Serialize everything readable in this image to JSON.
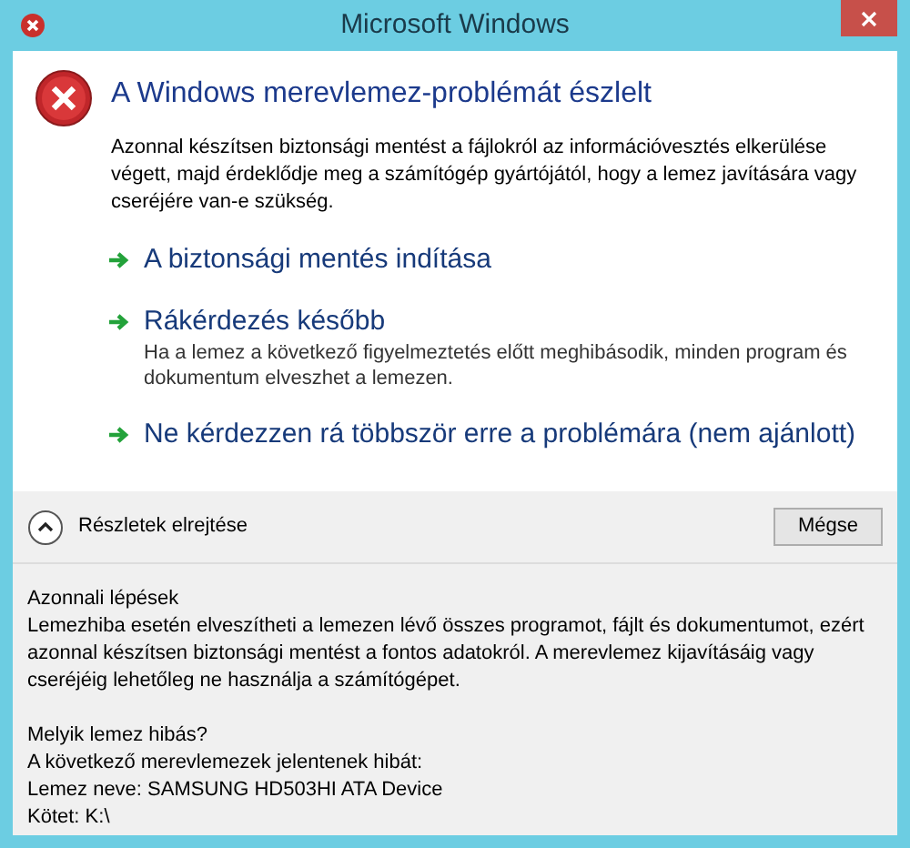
{
  "window": {
    "title": "Microsoft Windows"
  },
  "main_instruction": "A Windows merevlemez-problémát észlelt",
  "content": "Azonnal készítsen biztonsági mentést a fájlokról az információvesztés elkerülése végett, majd érdeklődje meg a számítógép gyártójától, hogy a lemez javítására vagy cseréjére van-e szükség.",
  "commands": [
    {
      "title": "A biztonsági mentés indítása"
    },
    {
      "title": "Rákérdezés később",
      "description": "Ha a lemez a következő figyelmeztetés előtt meghibásodik, minden program és dokumentum elveszhet a lemezen."
    },
    {
      "title": "Ne kérdezzen rá többször erre a problémára (nem ajánlott)"
    }
  ],
  "details_toggle": {
    "label": "Részletek elrejtése",
    "expanded": true
  },
  "buttons": [
    "Mégse"
  ],
  "details": [
    {
      "kind": "line",
      "text": "Azonnali lépések"
    },
    {
      "kind": "paragraph",
      "text": "Lemezhiba esetén elveszítheti a lemezen lévő összes programot, fájlt és dokumentumot, ezért azonnal készítsen biztonsági mentést a fontos adatokról. A merevlemez kijavításáig vagy cseréjéig lehetőleg ne használja a számítógépet."
    },
    {
      "kind": "gap"
    },
    {
      "kind": "line",
      "text": "Melyik lemez hibás?"
    },
    {
      "kind": "line",
      "text": "A következő merevlemezek jelentenek hibát:"
    },
    {
      "kind": "line",
      "text": "Lemez neve: SAMSUNG HD503HI ATA Device"
    },
    {
      "kind": "line",
      "text": "Kötet: K:\\"
    }
  ]
}
